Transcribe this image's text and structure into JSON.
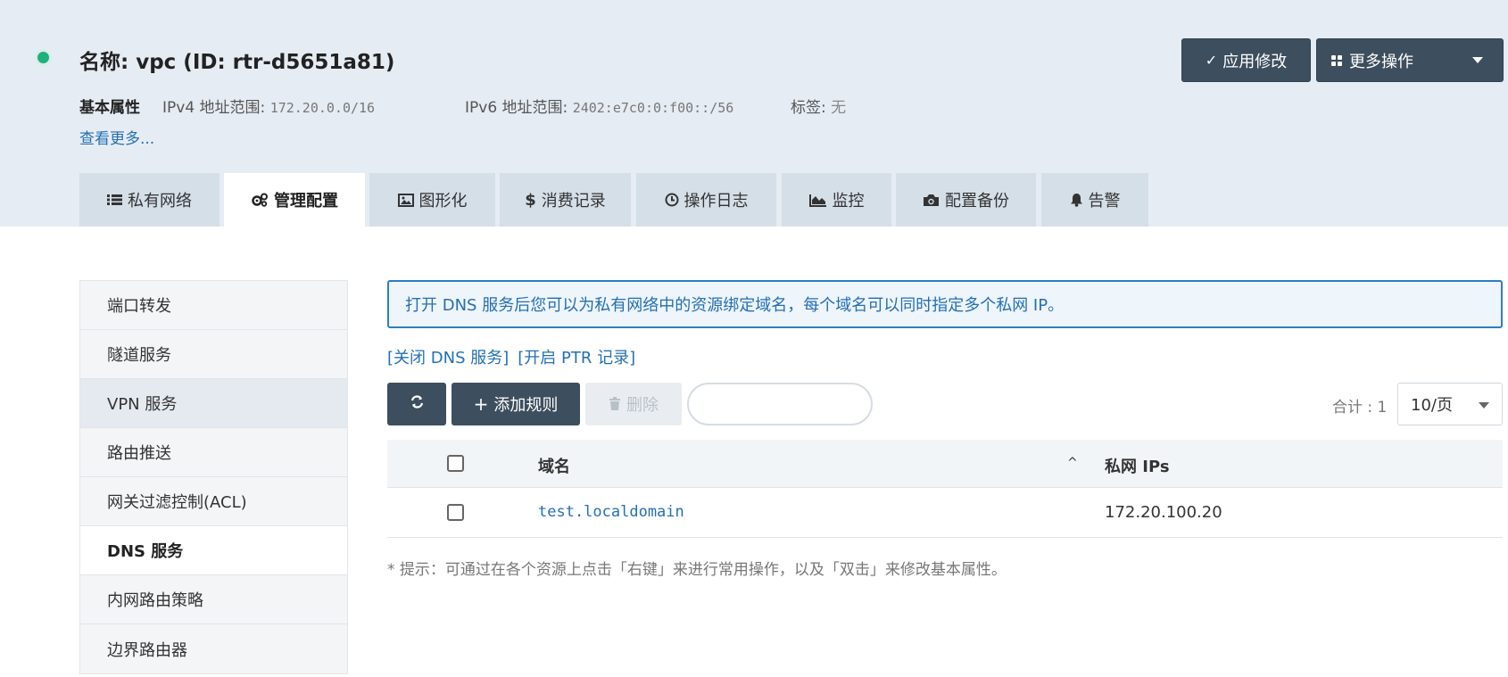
{
  "header": {
    "title": "名称: vpc (ID: rtr-d5651a81)",
    "props_label": "基本属性",
    "ipv4_label": "IPv4 地址范围:",
    "ipv4_value": "172.20.0.0/16",
    "ipv6_label": "IPv6 地址范围:",
    "ipv6_value": "2402:e7c0:0:f00::/56",
    "tags_label": "标签:",
    "tags_value": "无",
    "see_more": "查看更多...",
    "apply_label": "应用修改",
    "more_label": "更多操作",
    "status_color": "#1fb07f"
  },
  "tabs": [
    {
      "label": "私有网络",
      "icon": "list-icon"
    },
    {
      "label": "管理配置",
      "icon": "gears-icon",
      "active": true
    },
    {
      "label": "图形化",
      "icon": "image-icon"
    },
    {
      "label": "消费记录",
      "icon": "dollar-icon"
    },
    {
      "label": "操作日志",
      "icon": "clock-icon"
    },
    {
      "label": "监控",
      "icon": "area-chart-icon"
    },
    {
      "label": "配置备份",
      "icon": "camera-icon"
    },
    {
      "label": "告警",
      "icon": "bell-icon"
    }
  ],
  "sidebar": {
    "items": [
      {
        "label": "端口转发"
      },
      {
        "label": "隧道服务"
      },
      {
        "label": "VPN 服务"
      },
      {
        "label": "路由推送"
      },
      {
        "label": "网关过滤控制(ACL)"
      },
      {
        "label": "DNS 服务",
        "active": true
      },
      {
        "label": "内网路由策略"
      },
      {
        "label": "边界路由器"
      }
    ]
  },
  "main": {
    "info": "打开 DNS 服务后您可以为私有网络中的资源绑定域名，每个域名可以同时指定多个私网 IP。",
    "link_close_dns": "[关闭 DNS 服务]",
    "link_open_ptr": "[开启 PTR 记录]",
    "add_rule_label": "添加规则",
    "delete_label": "删除",
    "search_placeholder": "",
    "total_text": "合计 : 1",
    "page_size": "10/页",
    "table": {
      "headers": {
        "domain": "域名",
        "private_ips": "私网 IPs"
      },
      "rows": [
        {
          "domain": "test.localdomain",
          "private_ips": "172.20.100.20"
        }
      ]
    },
    "hint": "* 提示：可通过在各个资源上点击「右键」来进行常用操作，以及「双击」来修改基本属性。"
  },
  "colors": {
    "header_bg": "#e6ecf3",
    "tab_bg": "#d5dfe8",
    "dark_button": "#3d4e5e",
    "link_blue": "#2470b3",
    "info_border": "#2d7ec2"
  }
}
